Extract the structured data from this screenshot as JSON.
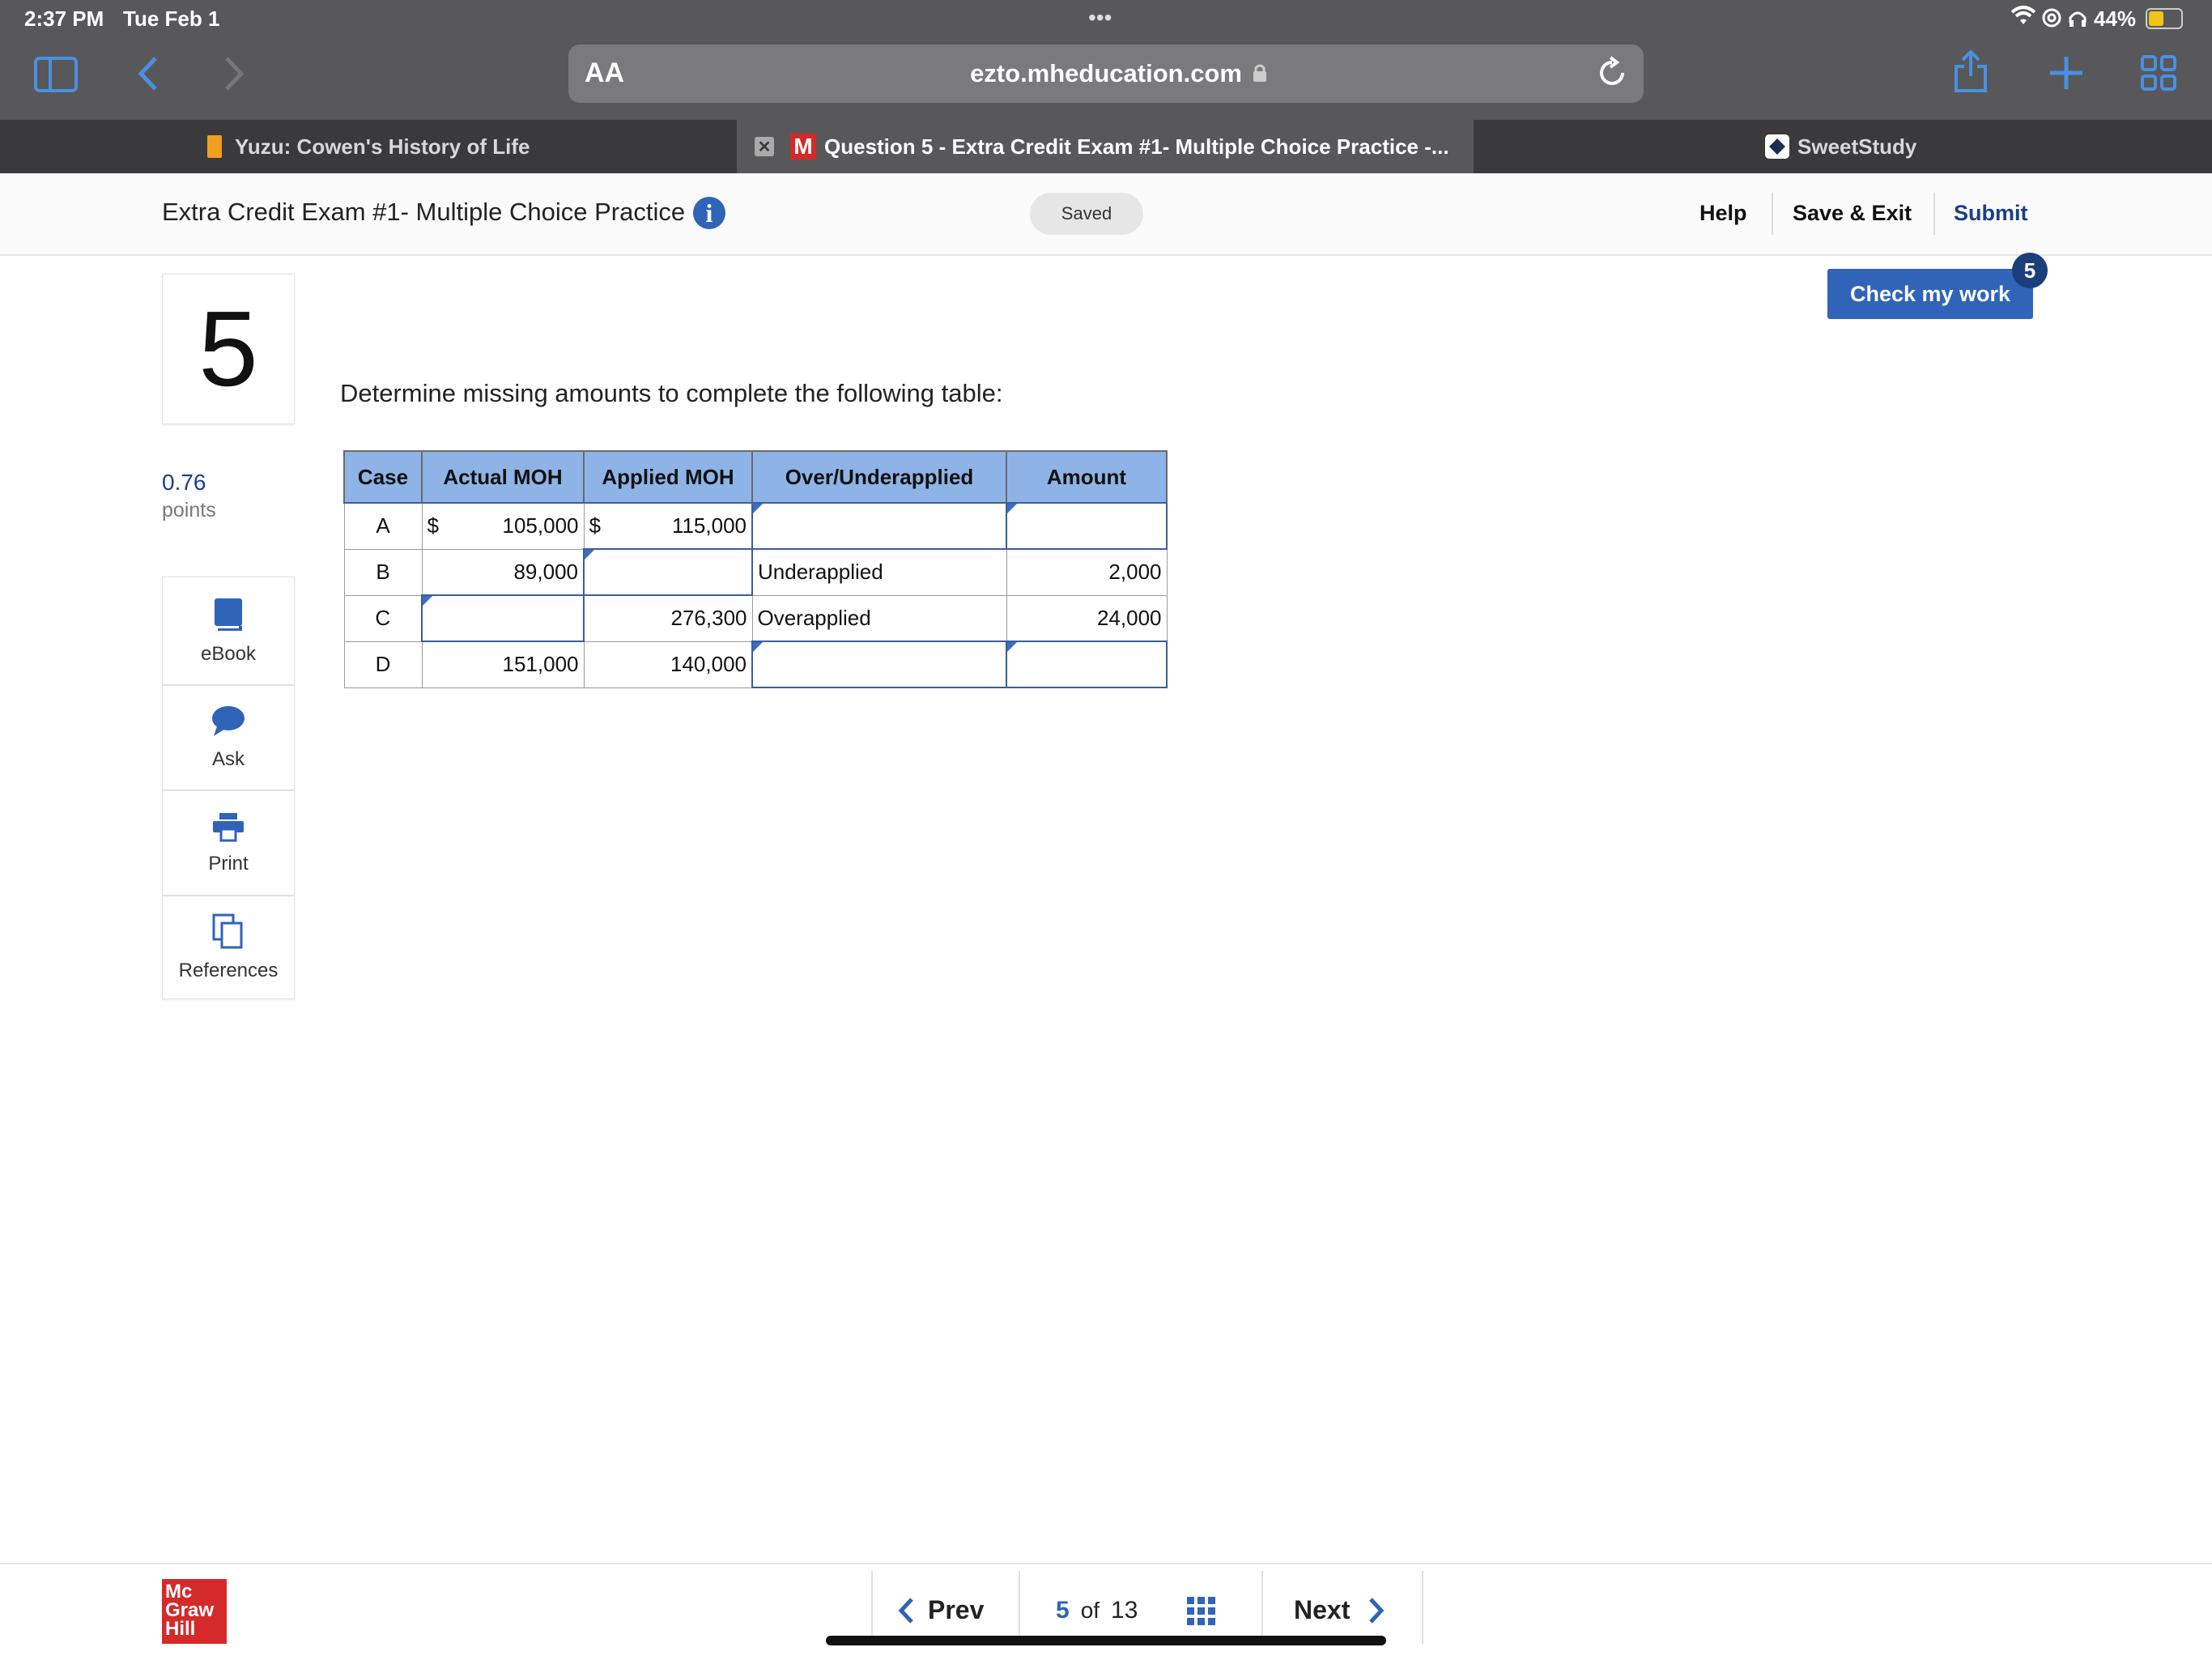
{
  "status_bar": {
    "time": "2:37 PM",
    "date": "Tue Feb 1",
    "battery": "44%"
  },
  "safari": {
    "text_size_label": "AA",
    "url": "ezto.mheducation.com",
    "tabs": [
      {
        "label": "Yuzu: Cowen's History of Life"
      },
      {
        "label": "Question 5 - Extra Credit Exam #1- Multiple Choice Practice -..."
      },
      {
        "label": "SweetStudy"
      }
    ]
  },
  "header": {
    "title": "Extra Credit Exam #1- Multiple Choice Practice",
    "saved": "Saved",
    "help": "Help",
    "save_exit": "Save & Exit",
    "submit": "Submit"
  },
  "check_work": {
    "label": "Check my work",
    "badge": "5"
  },
  "question": {
    "number": "5",
    "points_value": "0.76",
    "points_label": "points",
    "prompt": "Determine missing amounts to complete the following table:"
  },
  "sidebar": {
    "ebook": "eBook",
    "ask": "Ask",
    "print": "Print",
    "references": "References"
  },
  "table": {
    "headers": [
      "Case",
      "Actual MOH",
      "Applied MOH",
      "Over/Underapplied",
      "Amount"
    ],
    "rows": [
      {
        "case": "A",
        "actual_symbol": "$",
        "actual": "105,000",
        "applied_symbol": "$",
        "applied": "115,000",
        "over_under": "",
        "amount": ""
      },
      {
        "case": "B",
        "actual": "89,000",
        "applied": "",
        "over_under": "Underapplied",
        "amount": "2,000"
      },
      {
        "case": "C",
        "actual": "",
        "applied": "276,300",
        "over_under": "Overapplied",
        "amount": "24,000"
      },
      {
        "case": "D",
        "actual": "151,000",
        "applied": "140,000",
        "over_under": "",
        "amount": ""
      }
    ]
  },
  "footer": {
    "logo_lines": [
      "Mc",
      "Graw",
      "Hill"
    ],
    "prev": "Prev",
    "current": "5",
    "of": "of",
    "total": "13",
    "next": "Next"
  }
}
